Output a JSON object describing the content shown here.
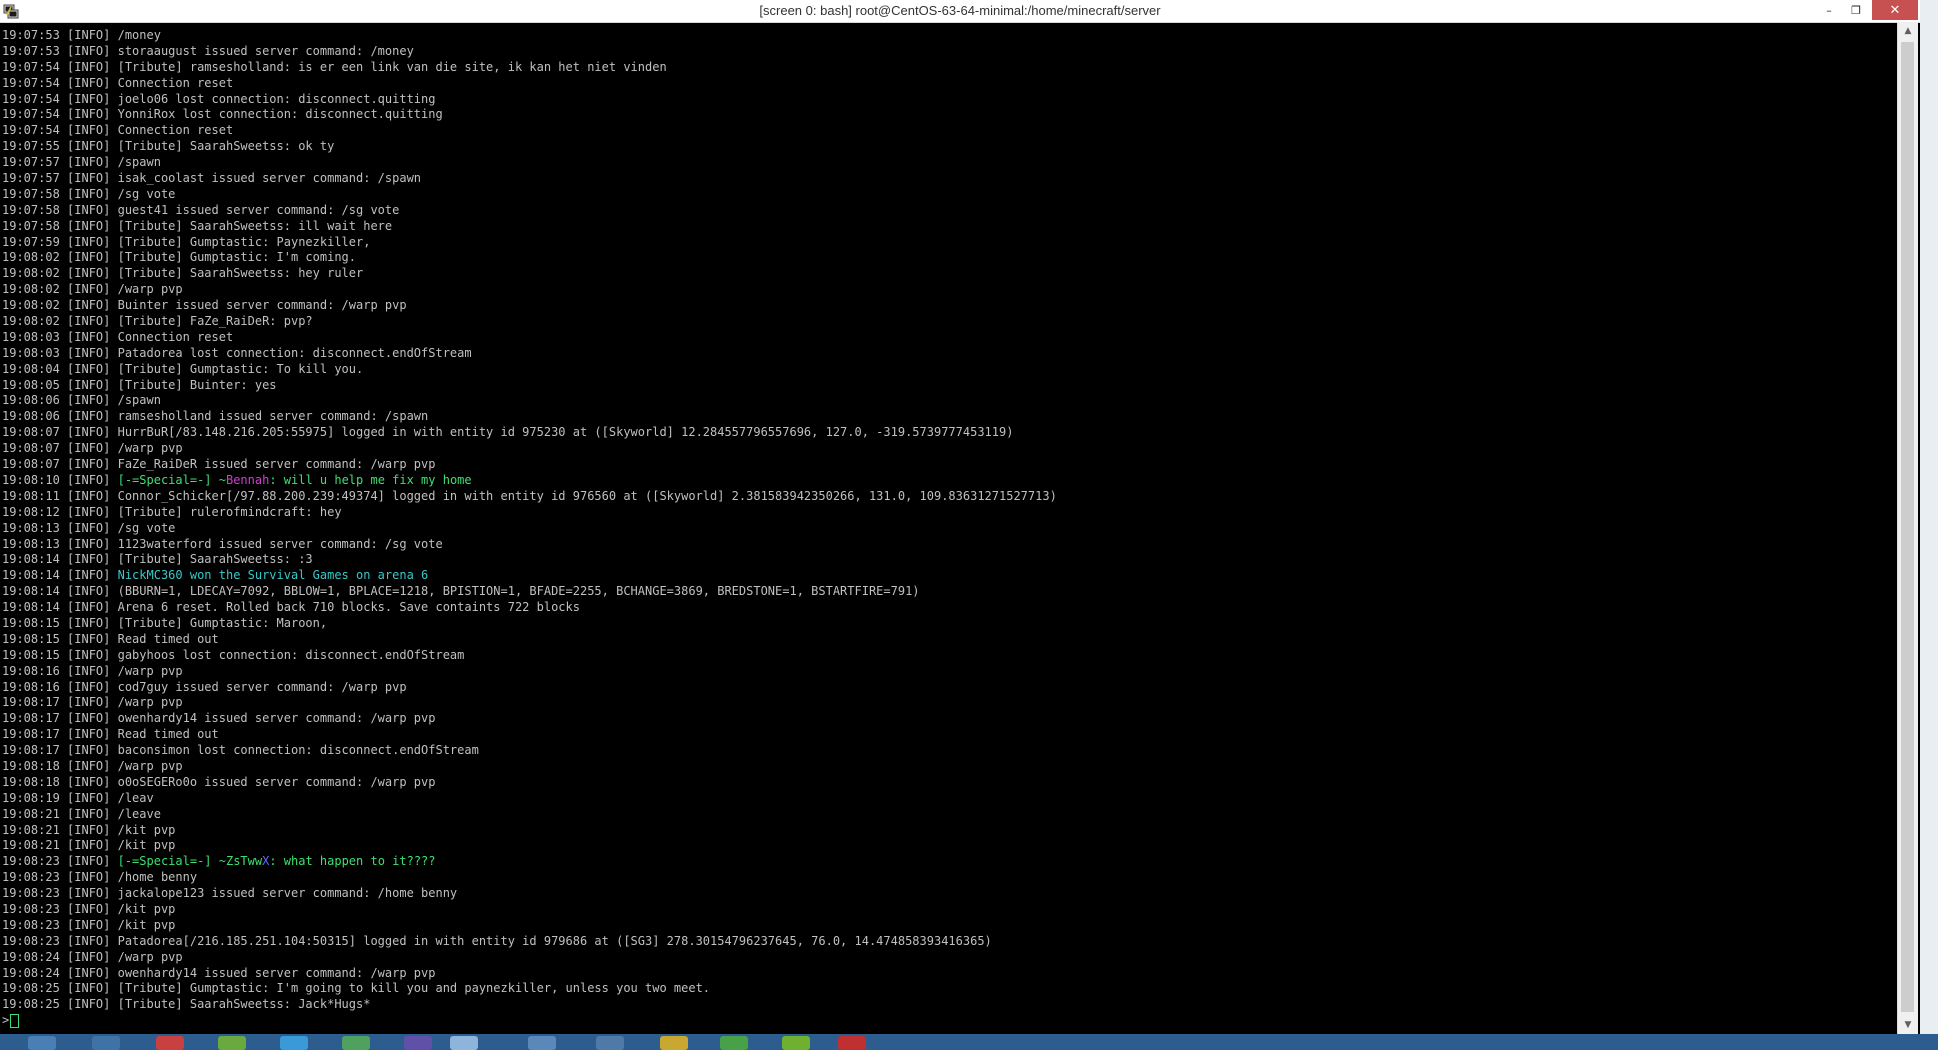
{
  "window": {
    "title": "[screen 0: bash] root@CentOS-63-64-minimal:/home/minecraft/server",
    "min_glyph": "–",
    "max_glyph": "❐",
    "close_glyph": "✕"
  },
  "colors": {
    "special_green": "#3ce070",
    "magenta": "#d040d0",
    "blue": "#5a6cff",
    "cyan": "#38c8c8",
    "default_text": "#c0c0c0"
  },
  "terminal": {
    "lines": [
      "19:07:53 [INFO] /money",
      "19:07:53 [INFO] storaaugust issued server command: /money",
      "19:07:54 [INFO] [Tribute] ramsesholland: is er een link van die site, ik kan het niet vinden",
      "19:07:54 [INFO] Connection reset",
      "19:07:54 [INFO] joelo06 lost connection: disconnect.quitting",
      "19:07:54 [INFO] YonniRox lost connection: disconnect.quitting",
      "19:07:54 [INFO] Connection reset",
      "19:07:55 [INFO] [Tribute] SaarahSweetss: ok ty",
      "19:07:57 [INFO] /spawn",
      "19:07:57 [INFO] isak_coolast issued server command: /spawn",
      "19:07:58 [INFO] /sg vote",
      "19:07:58 [INFO] guest41 issued server command: /sg vote",
      "19:07:58 [INFO] [Tribute] SaarahSweetss: ill wait here",
      "19:07:59 [INFO] [Tribute] Gumptastic: Paynezkiller,",
      "19:08:02 [INFO] [Tribute] Gumptastic: I'm coming.",
      "19:08:02 [INFO] [Tribute] SaarahSweetss: hey ruler",
      "19:08:02 [INFO] /warp pvp",
      "19:08:02 [INFO] Buinter issued server command: /warp pvp",
      "19:08:02 [INFO] [Tribute] FaZe_RaiDeR: pvp?",
      "19:08:03 [INFO] Connection reset",
      "19:08:03 [INFO] Patadorea lost connection: disconnect.endOfStream",
      "19:08:04 [INFO] [Tribute] Gumptastic: To kill you.",
      "19:08:05 [INFO] [Tribute] Buinter: yes",
      "19:08:06 [INFO] /spawn",
      "19:08:06 [INFO] ramsesholland issued server command: /spawn",
      "19:08:07 [INFO] HurrBuR[/83.148.216.205:55975] logged in with entity id 975230 at ([Skyworld] 12.284557796557696, 127.0, -319.5739777453119)",
      "19:08:07 [INFO] /warp pvp",
      "19:08:07 [INFO] FaZe_RaiDeR issued server command: /warp pvp",
      null,
      "19:08:11 [INFO] Connor_Schicker[/97.88.200.239:49374] logged in with entity id 976560 at ([Skyworld] 2.381583942350266, 131.0, 109.83631271527713)",
      "19:08:12 [INFO] [Tribute] rulerofmindcraft: hey",
      "19:08:13 [INFO] /sg vote",
      "19:08:13 [INFO] 1123waterford issued server command: /sg vote",
      "19:08:14 [INFO] [Tribute] SaarahSweetss: :3",
      null,
      "19:08:14 [INFO] (BBURN=1, LDECAY=7092, BBLOW=1, BPLACE=1218, BPISTION=1, BFADE=2255, BCHANGE=3869, BREDSTONE=1, BSTARTFIRE=791)",
      "19:08:14 [INFO] Arena 6 reset. Rolled back 710 blocks. Save containts 722 blocks",
      "19:08:15 [INFO] [Tribute] Gumptastic: Maroon,",
      "19:08:15 [INFO] Read timed out",
      "19:08:15 [INFO] gabyhoos lost connection: disconnect.endOfStream",
      "19:08:16 [INFO] /warp pvp",
      "19:08:16 [INFO] cod7guy issued server command: /warp pvp",
      "19:08:17 [INFO] /warp pvp",
      "19:08:17 [INFO] owenhardy14 issued server command: /warp pvp",
      "19:08:17 [INFO] Read timed out",
      "19:08:17 [INFO] baconsimon lost connection: disconnect.endOfStream",
      "19:08:18 [INFO] /warp pvp",
      "19:08:18 [INFO] o0oSEGERo0o issued server command: /warp pvp",
      "19:08:19 [INFO] /leav",
      "19:08:21 [INFO] /leave",
      "19:08:21 [INFO] /kit pvp",
      "19:08:21 [INFO] /kit pvp",
      null,
      "19:08:23 [INFO] /home benny",
      "19:08:23 [INFO] jackalope123 issued server command: /home benny",
      "19:08:23 [INFO] /kit pvp",
      "19:08:23 [INFO] /kit pvp",
      "19:08:23 [INFO] Patadorea[/216.185.251.104:50315] logged in with entity id 979686 at ([SG3] 278.30154796237645, 76.0, 14.474858393416365)",
      "19:08:24 [INFO] /warp pvp",
      "19:08:24 [INFO] owenhardy14 issued server command: /warp pvp",
      "19:08:25 [INFO] [Tribute] Gumptastic: I'm going to kill you and paynezkiller, unless you two meet.",
      "19:08:25 [INFO] [Tribute] SaarahSweetss: Jack*Hugs*"
    ],
    "special1": {
      "prefix": "19:08:10 [INFO] ",
      "tag": "[-=Special=-] ~",
      "name": "Bennah",
      "message": ": will u help me fix my home"
    },
    "won": {
      "prefix": "19:08:14 [INFO] ",
      "message": "NickMC360 won the Survival Games on arena 6"
    },
    "special2": {
      "prefix": "19:08:23 [INFO] ",
      "tag": "[-=Special=-] ~",
      "name_a": "ZsTww",
      "name_b": "X",
      "message": ": what happen to it????"
    },
    "prompt": ">"
  }
}
